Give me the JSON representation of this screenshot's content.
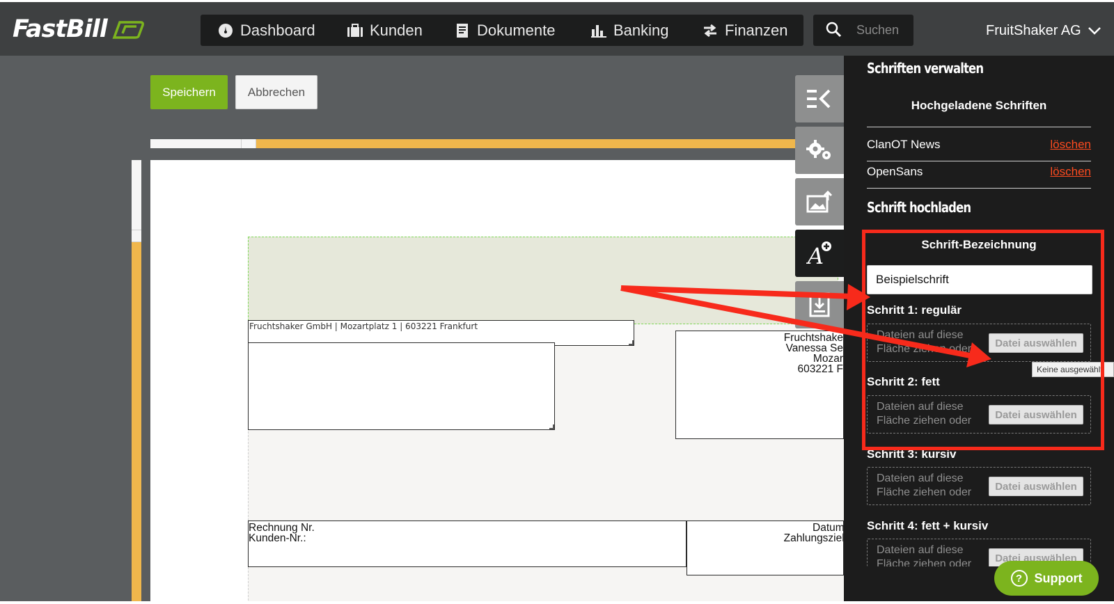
{
  "brand": {
    "logo_text": "FastBill",
    "accent": "#7cb41e"
  },
  "nav": {
    "items": [
      {
        "label": "Dashboard",
        "icon": "gauge-icon"
      },
      {
        "label": "Kunden",
        "icon": "briefcase-icon"
      },
      {
        "label": "Dokumente",
        "icon": "document-icon"
      },
      {
        "label": "Banking",
        "icon": "bar-chart-icon"
      },
      {
        "label": "Finanzen",
        "icon": "transfer-arrows-icon"
      }
    ],
    "search_placeholder": "Suchen",
    "account_name": "FruitShaker AG"
  },
  "toolbar": {
    "save_label": "Speichern",
    "cancel_label": "Abbrechen"
  },
  "document": {
    "sender_line": "Fruchtshaker GmbH | Mozartplatz 1 | 603221 Frankfurt",
    "company_block": [
      "Fruchtshake",
      "Vanessa Se",
      "Mozar",
      "603221 F"
    ],
    "invoice_no_label": "Rechnung Nr.",
    "customer_no_label": "Kunden-Nr.:",
    "date_label": "Datum:",
    "payment_term_label": "Zahlungsziel:"
  },
  "tools": [
    "collapse-panel-icon",
    "settings-gears-icon",
    "image-upload-icon",
    "font-add-icon",
    "pdf-import-icon"
  ],
  "panel": {
    "title": "Schriften verwalten",
    "uploaded_heading": "Hochgeladene Schriften",
    "fonts": [
      {
        "name": "ClanOT News",
        "delete_label": "löschen"
      },
      {
        "name": "OpenSans",
        "delete_label": "löschen"
      }
    ],
    "upload_heading": "Schrift hochladen",
    "name_label": "Schrift-Bezeichnung",
    "name_value": "Beispielschrift",
    "steps": [
      {
        "label": "Schritt 1: regulär"
      },
      {
        "label": "Schritt 2: fett"
      },
      {
        "label": "Schritt 3: kursiv"
      },
      {
        "label": "Schritt 4: fett + kursiv"
      }
    ],
    "drop_hint": "Dateien auf diese Fläche ziehen oder",
    "choose_label": "Datei auswählen",
    "no_file_tooltip": "Keine ausgewählt"
  },
  "support_label": "Support",
  "colors": {
    "highlight": "#f72a1b",
    "scroll": "#f0b74c",
    "delete_link": "#ff4b1f"
  }
}
